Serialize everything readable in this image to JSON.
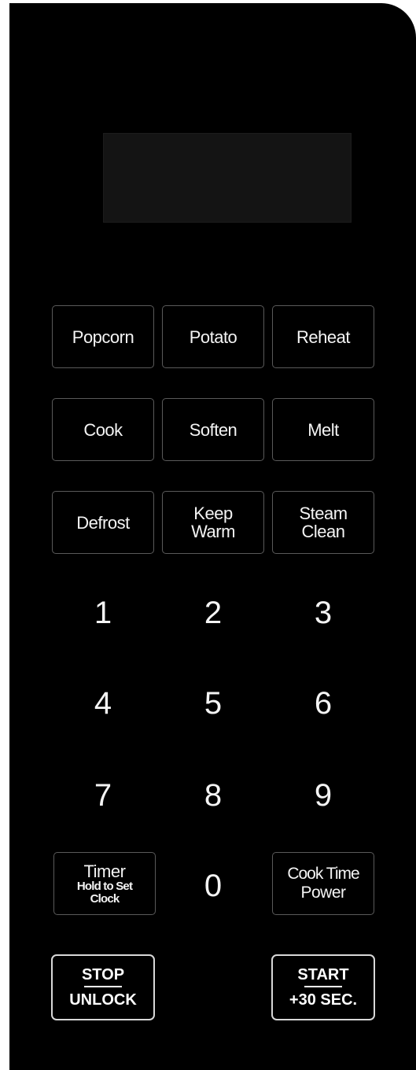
{
  "presets": [
    {
      "id": "popcorn",
      "label": "Popcorn"
    },
    {
      "id": "potato",
      "label": "Potato"
    },
    {
      "id": "reheat",
      "label": "Reheat"
    },
    {
      "id": "cook",
      "label": "Cook"
    },
    {
      "id": "soften",
      "label": "Soften"
    },
    {
      "id": "melt",
      "label": "Melt"
    },
    {
      "id": "defrost",
      "label": "Defrost"
    }
  ],
  "keep_warm": {
    "line1": "Keep",
    "line2": "Warm"
  },
  "steam_clean": {
    "line1": "Steam",
    "line2": "Clean"
  },
  "digits": [
    "1",
    "2",
    "3",
    "4",
    "5",
    "6",
    "7",
    "8",
    "9",
    "0"
  ],
  "timer": {
    "line1": "Timer",
    "line2": "Hold to Set",
    "line3": "Clock"
  },
  "cook_time_power": {
    "line1": "Cook Time",
    "line2": "Power"
  },
  "stop": {
    "top": "STOP",
    "bottom": "UNLOCK"
  },
  "start": {
    "top": "START",
    "bottom": "+30 SEC."
  },
  "colors": {
    "panel": "#000000",
    "button_border": "#5a5a5a",
    "text": "#f4f4f4",
    "display": "#141414"
  }
}
